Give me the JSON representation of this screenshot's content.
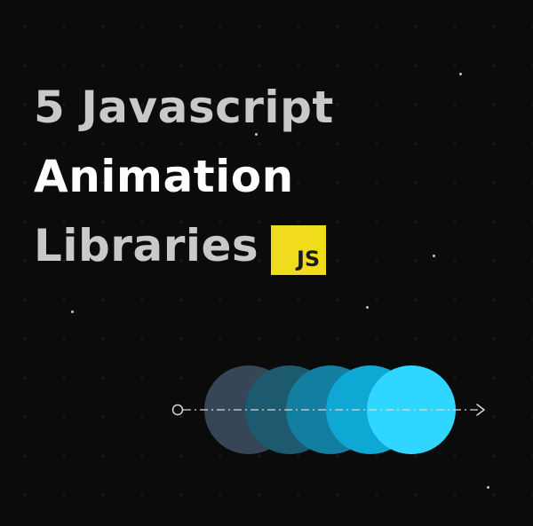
{
  "title": {
    "line1": "5 Javascript",
    "line2": "Animation",
    "line3": "Libraries"
  },
  "badge": {
    "label": "JS",
    "color": "#f0db1c"
  },
  "animation": {
    "circles": [
      {
        "color": "#364656"
      },
      {
        "color": "#1d5a70"
      },
      {
        "color": "#137ea0"
      },
      {
        "color": "#0fa7d4"
      },
      {
        "color": "#2fd6ff"
      }
    ],
    "path_color": "#d8d8d8",
    "start_icon": "hollow-circle-icon",
    "end_icon": "arrow-right-icon"
  },
  "colors": {
    "background": "#0b0b0c",
    "title_gray": "#c9c9c9",
    "title_white": "#ffffff"
  }
}
